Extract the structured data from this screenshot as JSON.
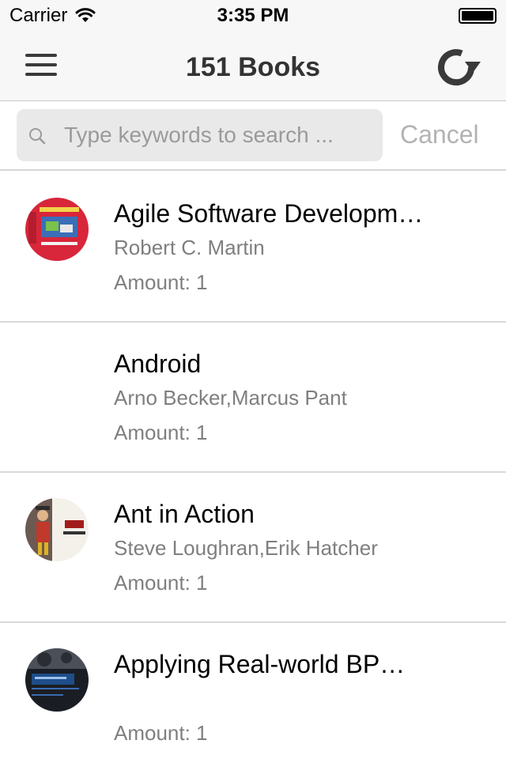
{
  "status_bar": {
    "carrier": "Carrier",
    "time": "3:35 PM",
    "battery_level": 1.0
  },
  "nav": {
    "title": "151 Books",
    "menu_icon": "hamburger-menu-icon",
    "refresh_icon": "refresh-icon"
  },
  "search": {
    "placeholder": "Type keywords to search ...",
    "value": "",
    "cancel_label": "Cancel"
  },
  "books": [
    {
      "title": "Agile Software Developm…",
      "author": "Robert C. Martin",
      "amount": "Amount: 1",
      "cover": "linux-programming-cover"
    },
    {
      "title": "Android",
      "author": "Arno Becker,Marcus Pant",
      "amount": "Amount: 1",
      "cover": "none"
    },
    {
      "title": "Ant in Action",
      "author": "Steve Loughran,Erik Hatcher",
      "amount": "Amount: 1",
      "cover": "ant-in-action-cover"
    },
    {
      "title": "Applying Real-world BP…",
      "author": "",
      "amount": "Amount: 1",
      "cover": "applying-real-world-bpm-cover"
    }
  ],
  "colors": {
    "bar_background": "#f7f7f7",
    "secondary_text": "#7f7f7f",
    "cancel_text": "#b3b3b3",
    "search_field": "#e9e9e9"
  }
}
